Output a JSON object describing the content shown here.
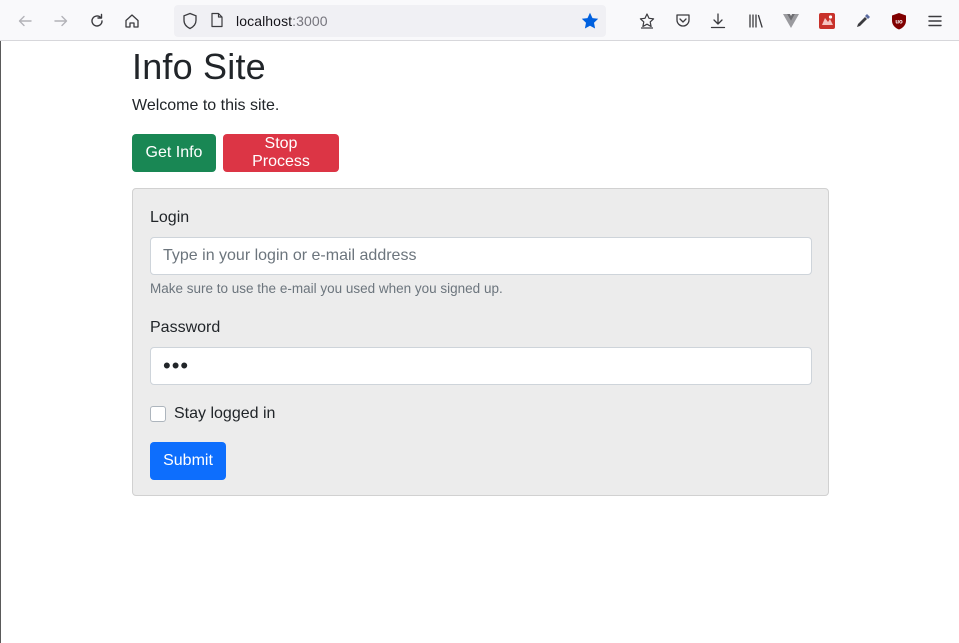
{
  "browser": {
    "url_host": "localhost",
    "url_port": ":3000",
    "star_color": "#0060df"
  },
  "page": {
    "title": "Info Site",
    "welcome": "Welcome to this site.",
    "buttons": {
      "get_info": "Get Info",
      "stop_process": "Stop Process"
    },
    "form": {
      "login_label": "Login",
      "login_placeholder": "Type in your login or e-mail address",
      "login_value": "",
      "login_help": "Make sure to use the e-mail you used when you signed up.",
      "password_label": "Password",
      "password_value": "abc",
      "stay_logged_in_label": "Stay logged in",
      "stay_logged_in_checked": false,
      "submit_label": "Submit"
    }
  },
  "colors": {
    "success": "#198754",
    "danger": "#dc3545",
    "primary": "#0d6efd"
  }
}
